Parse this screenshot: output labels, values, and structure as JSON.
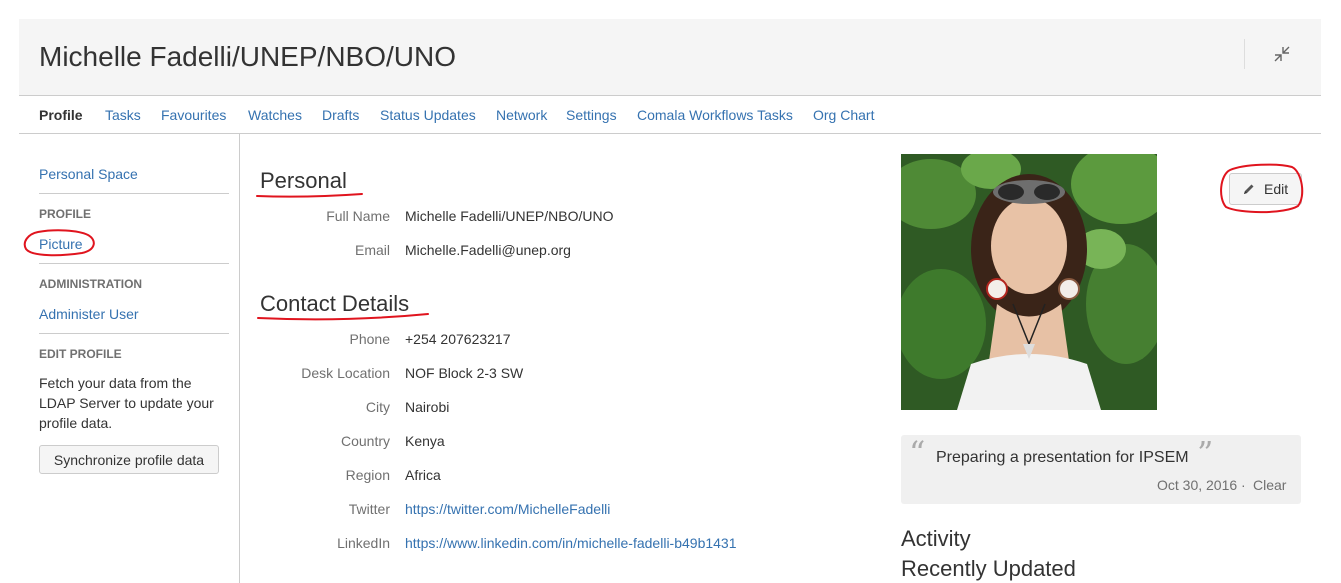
{
  "header": {
    "title": "Michelle Fadelli/UNEP/NBO/UNO",
    "collapse_icon": "collapse-icon"
  },
  "tabs": [
    {
      "label": "Profile",
      "active": true
    },
    {
      "label": "Tasks"
    },
    {
      "label": "Favourites"
    },
    {
      "label": "Watches"
    },
    {
      "label": "Drafts"
    },
    {
      "label": "Status Updates"
    },
    {
      "label": "Network"
    },
    {
      "label": "Settings"
    },
    {
      "label": "Comala Workflows Tasks"
    },
    {
      "label": "Org Chart"
    }
  ],
  "sidebar": {
    "personal_space": "Personal Space",
    "profile_heading": "PROFILE",
    "picture": "Picture",
    "admin_heading": "ADMINISTRATION",
    "administer_user": "Administer User",
    "edit_profile_heading": "EDIT PROFILE",
    "edit_profile_desc": "Fetch your data from the LDAP Server to update your profile data.",
    "sync_button": "Synchronize profile data"
  },
  "personal": {
    "heading": "Personal",
    "full_name_label": "Full Name",
    "full_name": "Michelle Fadelli/UNEP/NBO/UNO",
    "email_label": "Email",
    "email": "Michelle.Fadelli@unep.org"
  },
  "contact": {
    "heading": "Contact Details",
    "phone_label": "Phone",
    "phone": "+254 207623217",
    "desk_label": "Desk Location",
    "desk": "NOF Block 2-3 SW",
    "city_label": "City",
    "city": "Nairobi",
    "country_label": "Country",
    "country": "Kenya",
    "region_label": "Region",
    "region": "Africa",
    "twitter_label": "Twitter",
    "twitter": "https://twitter.com/MichelleFadelli",
    "linkedin_label": "LinkedIn",
    "linkedin": "https://www.linkedin.com/in/michelle-fadelli-b49b1431"
  },
  "edit_button": "Edit",
  "status": {
    "text": "Preparing a presentation for IPSEM",
    "date": "Oct 30, 2016",
    "separator": "·",
    "clear": "Clear",
    "open_quote": "“",
    "close_quote": "”"
  },
  "activity_heading": "Activity",
  "recently_updated_heading": "Recently Updated",
  "colors": {
    "link": "#3572b0",
    "annotation": "#e0141e",
    "header_bg": "#f5f5f5"
  }
}
